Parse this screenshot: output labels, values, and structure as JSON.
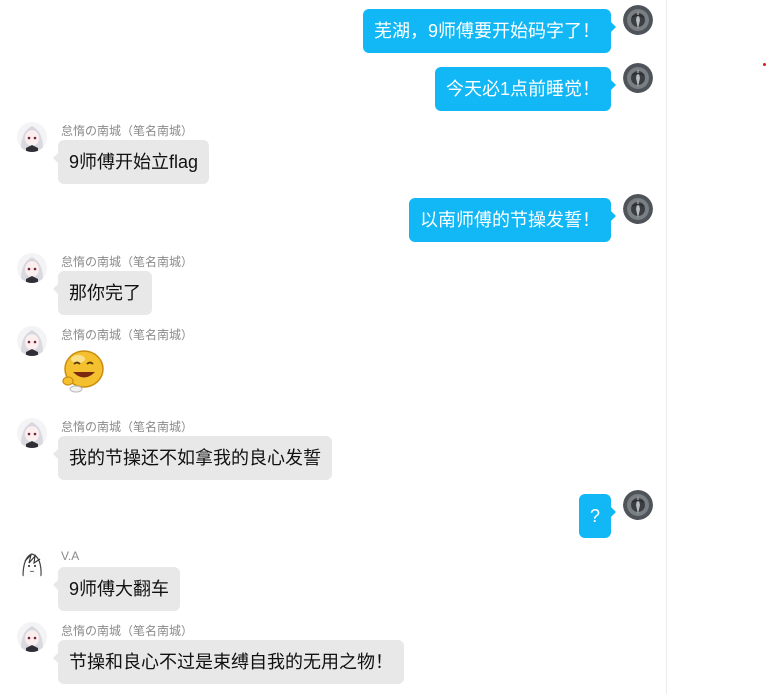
{
  "colors": {
    "outgoing_bubble": "#12b7f5",
    "incoming_bubble": "#e8e8e8",
    "sender_name": "#8a8a8a",
    "unread_dot": "#e01e1e"
  },
  "messages": [
    {
      "direction": "outgoing",
      "text": "芜湖，9师傅要开始码字了！",
      "avatar": "dark-medallion-avatar"
    },
    {
      "direction": "outgoing",
      "text": "今天必1点前睡觉！",
      "avatar": "dark-medallion-avatar"
    },
    {
      "direction": "incoming",
      "sender": "怠惰の南城（笔名南城）",
      "text": "9师傅开始立flag",
      "avatar": "anime-girl-avatar"
    },
    {
      "direction": "outgoing",
      "text": "以南师傅的节操发誓！",
      "avatar": "dark-medallion-avatar"
    },
    {
      "direction": "incoming",
      "sender": "怠惰の南城（笔名南城）",
      "text": "那你完了",
      "avatar": "anime-girl-avatar"
    },
    {
      "direction": "incoming",
      "sender": "怠惰の南城（笔名南城）",
      "sticker": "yellow-smiley-sticker",
      "avatar": "anime-girl-avatar"
    },
    {
      "direction": "incoming",
      "sender": "怠惰の南城（笔名南城）",
      "text": "我的节操还不如拿我的良心发誓",
      "avatar": "anime-girl-avatar"
    },
    {
      "direction": "outgoing",
      "text": "?",
      "avatar": "dark-medallion-avatar"
    },
    {
      "direction": "incoming",
      "sender": "V.A",
      "text": "9师傅大翻车",
      "avatar": "sketch-avatar"
    },
    {
      "direction": "incoming",
      "sender": "怠惰の南城（笔名南城）",
      "text": "节操和良心不过是束缚自我的无用之物！",
      "avatar": "anime-girl-avatar"
    }
  ]
}
